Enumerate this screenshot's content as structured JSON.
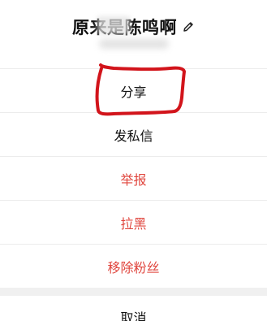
{
  "header": {
    "title": "原来是陈鸣啊",
    "edit_icon": "pencil-icon"
  },
  "menu": {
    "items": [
      {
        "label": "分享",
        "style": "normal"
      },
      {
        "label": "发私信",
        "style": "normal"
      },
      {
        "label": "举报",
        "style": "danger"
      },
      {
        "label": "拉黑",
        "style": "danger"
      },
      {
        "label": "移除粉丝",
        "style": "danger"
      }
    ],
    "cancel_label": "取消"
  },
  "colors": {
    "danger": "#e0463e",
    "annotation": "#d2141b",
    "text": "#111111",
    "separator": "#ececec"
  }
}
